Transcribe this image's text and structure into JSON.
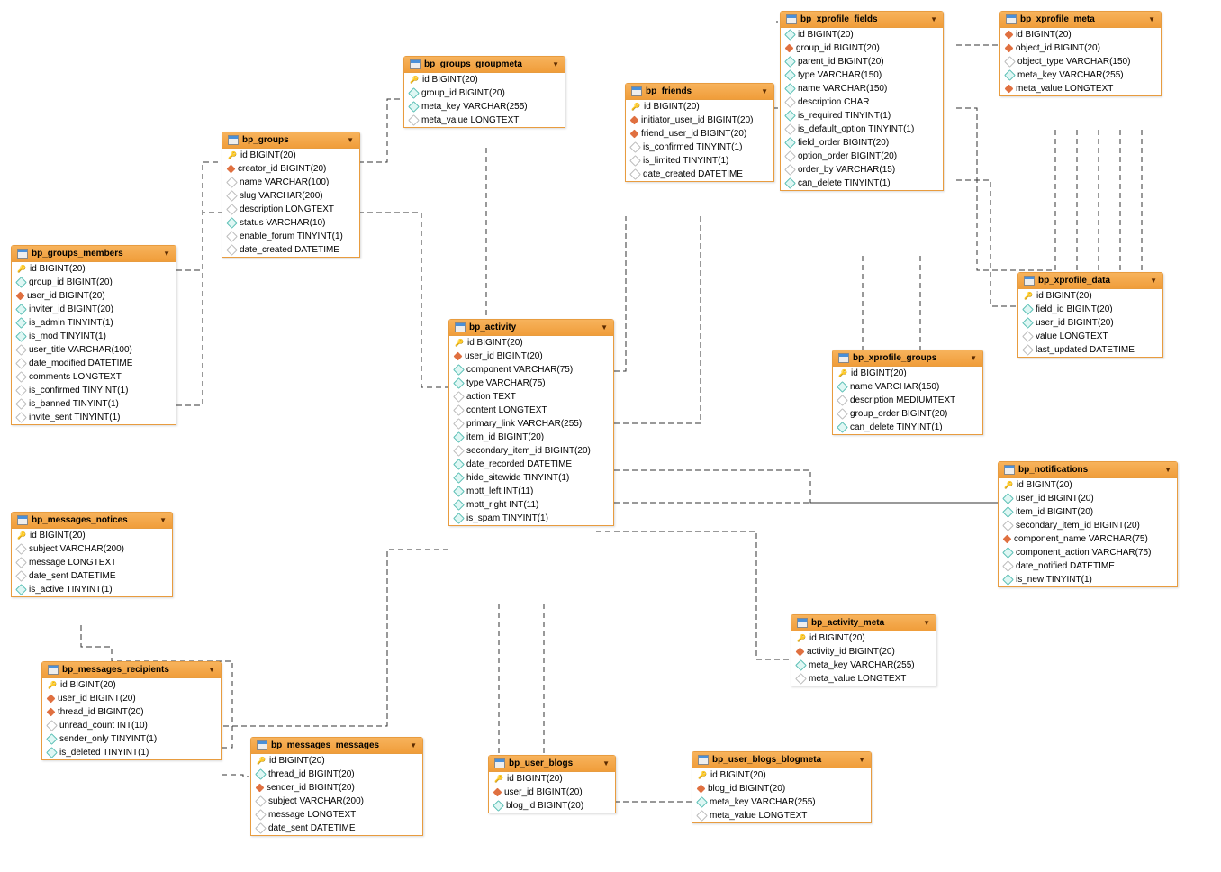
{
  "tables": {
    "bp_groups_groupmeta": {
      "title": "bp_groups_groupmeta",
      "cols": [
        {
          "icon": "key",
          "text": "id BIGINT(20)"
        },
        {
          "icon": "idx",
          "text": "group_id BIGINT(20)"
        },
        {
          "icon": "idx",
          "text": "meta_key VARCHAR(255)"
        },
        {
          "icon": "plain",
          "text": "meta_value LONGTEXT"
        }
      ]
    },
    "bp_friends": {
      "title": "bp_friends",
      "cols": [
        {
          "icon": "key",
          "text": "id BIGINT(20)"
        },
        {
          "icon": "fk",
          "text": "initiator_user_id BIGINT(20)"
        },
        {
          "icon": "fk",
          "text": "friend_user_id BIGINT(20)"
        },
        {
          "icon": "plain",
          "text": "is_confirmed TINYINT(1)"
        },
        {
          "icon": "plain",
          "text": "is_limited TINYINT(1)"
        },
        {
          "icon": "plain",
          "text": "date_created DATETIME"
        }
      ]
    },
    "bp_xprofile_fields": {
      "title": "bp_xprofile_fields",
      "cols": [
        {
          "icon": "idx",
          "text": "id BIGINT(20)"
        },
        {
          "icon": "fk",
          "text": "group_id BIGINT(20)"
        },
        {
          "icon": "idx",
          "text": "parent_id BIGINT(20)"
        },
        {
          "icon": "idx",
          "text": "type VARCHAR(150)"
        },
        {
          "icon": "idx",
          "text": "name VARCHAR(150)"
        },
        {
          "icon": "plain",
          "text": "description CHAR"
        },
        {
          "icon": "idx",
          "text": "is_required TINYINT(1)"
        },
        {
          "icon": "plain",
          "text": "is_default_option TINYINT(1)"
        },
        {
          "icon": "idx",
          "text": "field_order BIGINT(20)"
        },
        {
          "icon": "plain",
          "text": "option_order BIGINT(20)"
        },
        {
          "icon": "plain",
          "text": "order_by VARCHAR(15)"
        },
        {
          "icon": "idx",
          "text": "can_delete TINYINT(1)"
        }
      ]
    },
    "bp_xprofile_meta": {
      "title": "bp_xprofile_meta",
      "cols": [
        {
          "icon": "fk",
          "text": "id BIGINT(20)"
        },
        {
          "icon": "fk",
          "text": "object_id BIGINT(20)"
        },
        {
          "icon": "plain",
          "text": "object_type VARCHAR(150)"
        },
        {
          "icon": "idx",
          "text": "meta_key VARCHAR(255)"
        },
        {
          "icon": "fk",
          "text": "meta_value LONGTEXT"
        }
      ]
    },
    "bp_groups": {
      "title": "bp_groups",
      "cols": [
        {
          "icon": "key",
          "text": "id BIGINT(20)"
        },
        {
          "icon": "fk",
          "text": "creator_id BIGINT(20)"
        },
        {
          "icon": "plain",
          "text": "name VARCHAR(100)"
        },
        {
          "icon": "plain",
          "text": "slug VARCHAR(200)"
        },
        {
          "icon": "plain",
          "text": "description LONGTEXT"
        },
        {
          "icon": "idx",
          "text": "status VARCHAR(10)"
        },
        {
          "icon": "plain",
          "text": "enable_forum TINYINT(1)"
        },
        {
          "icon": "plain",
          "text": "date_created DATETIME"
        }
      ]
    },
    "bp_groups_members": {
      "title": "bp_groups_members",
      "cols": [
        {
          "icon": "key",
          "text": "id BIGINT(20)"
        },
        {
          "icon": "idx",
          "text": "group_id BIGINT(20)"
        },
        {
          "icon": "fk",
          "text": "user_id BIGINT(20)"
        },
        {
          "icon": "idx",
          "text": "inviter_id BIGINT(20)"
        },
        {
          "icon": "idx",
          "text": "is_admin TINYINT(1)"
        },
        {
          "icon": "idx",
          "text": "is_mod TINYINT(1)"
        },
        {
          "icon": "plain",
          "text": "user_title VARCHAR(100)"
        },
        {
          "icon": "plain",
          "text": "date_modified DATETIME"
        },
        {
          "icon": "plain",
          "text": "comments LONGTEXT"
        },
        {
          "icon": "plain",
          "text": "is_confirmed TINYINT(1)"
        },
        {
          "icon": "plain",
          "text": "is_banned TINYINT(1)"
        },
        {
          "icon": "plain",
          "text": "invite_sent TINYINT(1)"
        }
      ]
    },
    "bp_xprofile_data": {
      "title": "bp_xprofile_data",
      "cols": [
        {
          "icon": "key",
          "text": "id BIGINT(20)"
        },
        {
          "icon": "idx",
          "text": "field_id BIGINT(20)"
        },
        {
          "icon": "idx",
          "text": "user_id BIGINT(20)"
        },
        {
          "icon": "plain",
          "text": "value LONGTEXT"
        },
        {
          "icon": "plain",
          "text": "last_updated DATETIME"
        }
      ]
    },
    "bp_activity": {
      "title": "bp_activity",
      "cols": [
        {
          "icon": "key",
          "text": "id BIGINT(20)"
        },
        {
          "icon": "fk",
          "text": "user_id BIGINT(20)"
        },
        {
          "icon": "idx",
          "text": "component VARCHAR(75)"
        },
        {
          "icon": "idx",
          "text": "type VARCHAR(75)"
        },
        {
          "icon": "plain",
          "text": "action TEXT"
        },
        {
          "icon": "plain",
          "text": "content LONGTEXT"
        },
        {
          "icon": "plain",
          "text": "primary_link VARCHAR(255)"
        },
        {
          "icon": "idx",
          "text": "item_id BIGINT(20)"
        },
        {
          "icon": "plain",
          "text": "secondary_item_id BIGINT(20)"
        },
        {
          "icon": "idx",
          "text": "date_recorded DATETIME"
        },
        {
          "icon": "idx",
          "text": "hide_sitewide TINYINT(1)"
        },
        {
          "icon": "idx",
          "text": "mptt_left INT(11)"
        },
        {
          "icon": "idx",
          "text": "mptt_right INT(11)"
        },
        {
          "icon": "idx",
          "text": "is_spam TINYINT(1)"
        }
      ]
    },
    "bp_xprofile_groups": {
      "title": "bp_xprofile_groups",
      "cols": [
        {
          "icon": "key",
          "text": "id BIGINT(20)"
        },
        {
          "icon": "idx",
          "text": "name VARCHAR(150)"
        },
        {
          "icon": "plain",
          "text": "description MEDIUMTEXT"
        },
        {
          "icon": "plain",
          "text": "group_order BIGINT(20)"
        },
        {
          "icon": "idx",
          "text": "can_delete TINYINT(1)"
        }
      ]
    },
    "bp_notifications": {
      "title": "bp_notifications",
      "cols": [
        {
          "icon": "key",
          "text": "id BIGINT(20)"
        },
        {
          "icon": "idx",
          "text": "user_id BIGINT(20)"
        },
        {
          "icon": "idx",
          "text": "item_id BIGINT(20)"
        },
        {
          "icon": "plain",
          "text": "secondary_item_id BIGINT(20)"
        },
        {
          "icon": "fk",
          "text": "component_name VARCHAR(75)"
        },
        {
          "icon": "idx",
          "text": "component_action VARCHAR(75)"
        },
        {
          "icon": "plain",
          "text": "date_notified DATETIME"
        },
        {
          "icon": "idx",
          "text": "is_new TINYINT(1)"
        }
      ]
    },
    "bp_messages_notices": {
      "title": "bp_messages_notices",
      "cols": [
        {
          "icon": "key",
          "text": "id BIGINT(20)"
        },
        {
          "icon": "plain",
          "text": "subject VARCHAR(200)"
        },
        {
          "icon": "plain",
          "text": "message LONGTEXT"
        },
        {
          "icon": "plain",
          "text": "date_sent DATETIME"
        },
        {
          "icon": "idx",
          "text": "is_active TINYINT(1)"
        }
      ]
    },
    "bp_messages_recipients": {
      "title": "bp_messages_recipients",
      "cols": [
        {
          "icon": "key",
          "text": "id BIGINT(20)"
        },
        {
          "icon": "fk",
          "text": "user_id BIGINT(20)"
        },
        {
          "icon": "fk",
          "text": "thread_id BIGINT(20)"
        },
        {
          "icon": "plain",
          "text": "unread_count INT(10)"
        },
        {
          "icon": "idx",
          "text": "sender_only TINYINT(1)"
        },
        {
          "icon": "idx",
          "text": "is_deleted TINYINT(1)"
        }
      ]
    },
    "bp_activity_meta": {
      "title": "bp_activity_meta",
      "cols": [
        {
          "icon": "key",
          "text": "id BIGINT(20)"
        },
        {
          "icon": "fk",
          "text": "activity_id BIGINT(20)"
        },
        {
          "icon": "idx",
          "text": "meta_key VARCHAR(255)"
        },
        {
          "icon": "plain",
          "text": "meta_value LONGTEXT"
        }
      ]
    },
    "bp_messages_messages": {
      "title": "bp_messages_messages",
      "cols": [
        {
          "icon": "key",
          "text": "id BIGINT(20)"
        },
        {
          "icon": "idx",
          "text": "thread_id BIGINT(20)"
        },
        {
          "icon": "fk",
          "text": "sender_id BIGINT(20)"
        },
        {
          "icon": "plain",
          "text": "subject VARCHAR(200)"
        },
        {
          "icon": "plain",
          "text": "message LONGTEXT"
        },
        {
          "icon": "plain",
          "text": "date_sent DATETIME"
        }
      ]
    },
    "bp_user_blogs": {
      "title": "bp_user_blogs",
      "cols": [
        {
          "icon": "key",
          "text": "id BIGINT(20)"
        },
        {
          "icon": "fk",
          "text": "user_id BIGINT(20)"
        },
        {
          "icon": "idx",
          "text": "blog_id BIGINT(20)"
        }
      ]
    },
    "bp_user_blogs_blogmeta": {
      "title": "bp_user_blogs_blogmeta",
      "cols": [
        {
          "icon": "key",
          "text": "id BIGINT(20)"
        },
        {
          "icon": "fk",
          "text": "blog_id BIGINT(20)"
        },
        {
          "icon": "idx",
          "text": "meta_key VARCHAR(255)"
        },
        {
          "icon": "plain",
          "text": "meta_value LONGTEXT"
        }
      ]
    }
  }
}
